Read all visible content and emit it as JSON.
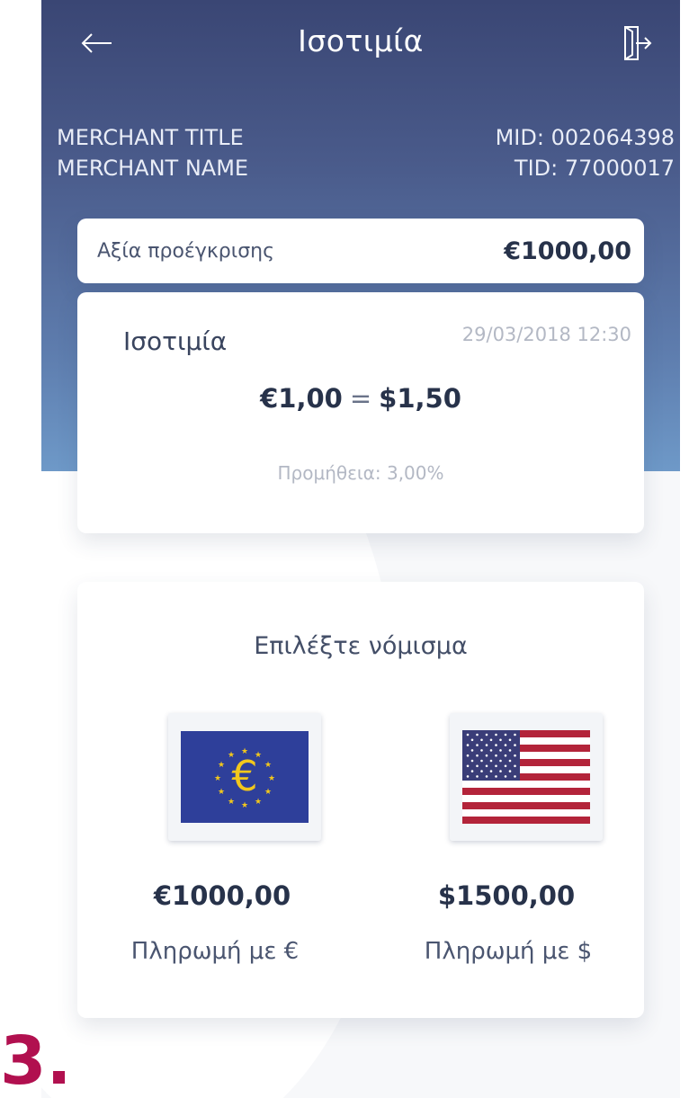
{
  "header": {
    "title": "Ισοτιμία",
    "back_icon": "arrow-left-icon",
    "exit_icon": "logout-door-icon"
  },
  "merchant": {
    "title": "MERCHANT TITLE",
    "name": "MERCHANT NAME",
    "mid": "MID: 002064398",
    "tid": "TID: 77000017"
  },
  "preauth": {
    "label": "Αξία προέγκρισης",
    "value": "€1000,00"
  },
  "rate_card": {
    "title": "Ισοτιμία",
    "datetime": "29/03/2018 12:30",
    "from_value": "€1,00",
    "equals": "=",
    "to_value": "$1,50",
    "fee": "Προμήθεια: 3,00%"
  },
  "currency_select": {
    "heading": "Επιλέξτε νόμισμα",
    "options": [
      {
        "flag_icon": "eu-flag-icon",
        "amount": "€1000,00",
        "label": "Πληρωμή με €"
      },
      {
        "flag_icon": "us-flag-icon",
        "amount": "$1500,00",
        "label": "Πληρωμή με $"
      }
    ]
  },
  "step_marker": "3.",
  "colors": {
    "header_top": "#3a4674",
    "header_bottom": "#6e99c8",
    "text_dark": "#27324a",
    "text_muted": "#b3b8c4",
    "eu_blue": "#2e3f9a",
    "eu_yellow": "#f2c71c",
    "us_red": "#b3243a",
    "us_blue": "#3a3d78",
    "step_red": "#b1104f"
  }
}
